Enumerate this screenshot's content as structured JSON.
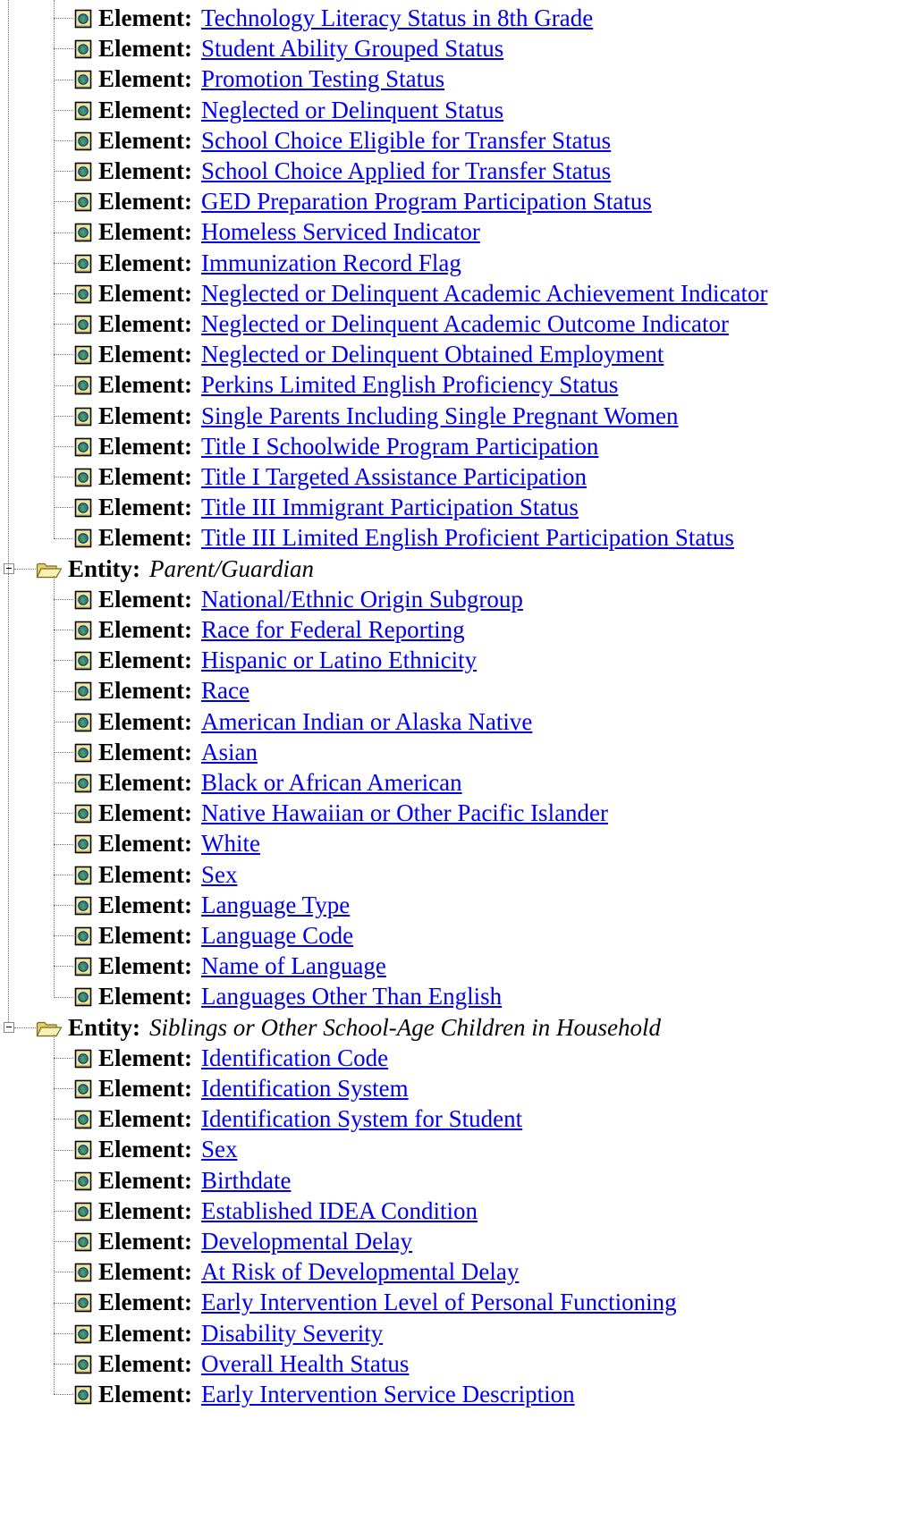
{
  "labels": {
    "element": "Element:",
    "entity": "Entity:"
  },
  "tree": [
    {
      "type": "element",
      "label": "Technology Literacy Status in 8th Grade"
    },
    {
      "type": "element",
      "label": "Student Ability Grouped Status"
    },
    {
      "type": "element",
      "label": "Promotion Testing Status"
    },
    {
      "type": "element",
      "label": "Neglected or Delinquent Status"
    },
    {
      "type": "element",
      "label": "School Choice Eligible for Transfer Status"
    },
    {
      "type": "element",
      "label": "School Choice Applied for Transfer Status"
    },
    {
      "type": "element",
      "label": "GED Preparation Program Participation Status"
    },
    {
      "type": "element",
      "label": "Homeless Serviced Indicator"
    },
    {
      "type": "element",
      "label": "Immunization Record Flag"
    },
    {
      "type": "element",
      "label": "Neglected or Delinquent Academic Achievement Indicator"
    },
    {
      "type": "element",
      "label": "Neglected or Delinquent Academic Outcome Indicator"
    },
    {
      "type": "element",
      "label": "Neglected or Delinquent Obtained Employment"
    },
    {
      "type": "element",
      "label": "Perkins Limited English Proficiency Status"
    },
    {
      "type": "element",
      "label": "Single Parents Including Single Pregnant Women"
    },
    {
      "type": "element",
      "label": "Title I Schoolwide Program Participation"
    },
    {
      "type": "element",
      "label": "Title I Targeted Assistance Participation"
    },
    {
      "type": "element",
      "label": "Title III Immigrant Participation Status"
    },
    {
      "type": "element",
      "label": "Title III Limited English Proficient Participation Status"
    },
    {
      "type": "entity",
      "label": "Parent/Guardian"
    },
    {
      "type": "element",
      "label": "National/Ethnic Origin Subgroup"
    },
    {
      "type": "element",
      "label": "Race for Federal Reporting"
    },
    {
      "type": "element",
      "label": "Hispanic or Latino Ethnicity"
    },
    {
      "type": "element",
      "label": "Race"
    },
    {
      "type": "element",
      "label": "American Indian or Alaska Native"
    },
    {
      "type": "element",
      "label": "Asian"
    },
    {
      "type": "element",
      "label": "Black or African American"
    },
    {
      "type": "element",
      "label": "Native Hawaiian or Other Pacific Islander"
    },
    {
      "type": "element",
      "label": "White"
    },
    {
      "type": "element",
      "label": "Sex"
    },
    {
      "type": "element",
      "label": "Language Type"
    },
    {
      "type": "element",
      "label": "Language Code"
    },
    {
      "type": "element",
      "label": "Name of Language"
    },
    {
      "type": "element",
      "label": "Languages Other Than English"
    },
    {
      "type": "entity",
      "label": "Siblings or Other School-Age Children in Household"
    },
    {
      "type": "element",
      "label": "Identification Code"
    },
    {
      "type": "element",
      "label": "Identification System"
    },
    {
      "type": "element",
      "label": "Identification System for Student"
    },
    {
      "type": "element",
      "label": "Sex"
    },
    {
      "type": "element",
      "label": "Birthdate"
    },
    {
      "type": "element",
      "label": "Established IDEA Condition"
    },
    {
      "type": "element",
      "label": "Developmental Delay"
    },
    {
      "type": "element",
      "label": "At Risk of Developmental Delay"
    },
    {
      "type": "element",
      "label": "Early Intervention Level of Personal Functioning"
    },
    {
      "type": "element",
      "label": "Disability Severity"
    },
    {
      "type": "element",
      "label": "Overall Health Status"
    },
    {
      "type": "element",
      "label": "Early Intervention Service Description"
    }
  ]
}
